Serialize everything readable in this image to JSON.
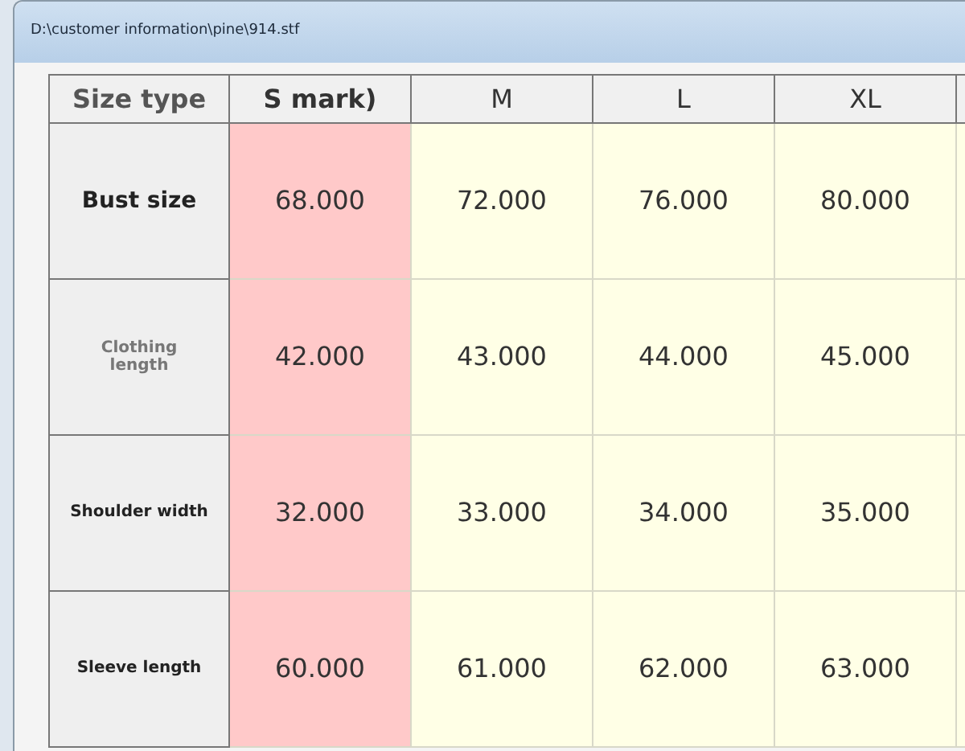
{
  "window": {
    "title": "D:\\customer information\\pine\\914.stf"
  },
  "table": {
    "corner": "Size type",
    "columns": [
      {
        "label": "S mark)",
        "selected": true
      },
      {
        "label": "M",
        "selected": false
      },
      {
        "label": "L",
        "selected": false
      },
      {
        "label": "XL",
        "selected": false
      }
    ],
    "rows": [
      {
        "label": "Bust size",
        "kind": "large",
        "cells": [
          "68.000",
          "72.000",
          "76.000",
          "80.000"
        ]
      },
      {
        "label": "Clothing length",
        "kind": "dim",
        "cells": [
          "42.000",
          "43.000",
          "44.000",
          "45.000"
        ]
      },
      {
        "label": "Shoulder width",
        "kind": "small",
        "cells": [
          "32.000",
          "33.000",
          "34.000",
          "35.000"
        ]
      },
      {
        "label": "Sleeve length",
        "kind": "small",
        "cells": [
          "60.000",
          "61.000",
          "62.000",
          "63.000"
        ]
      }
    ]
  }
}
